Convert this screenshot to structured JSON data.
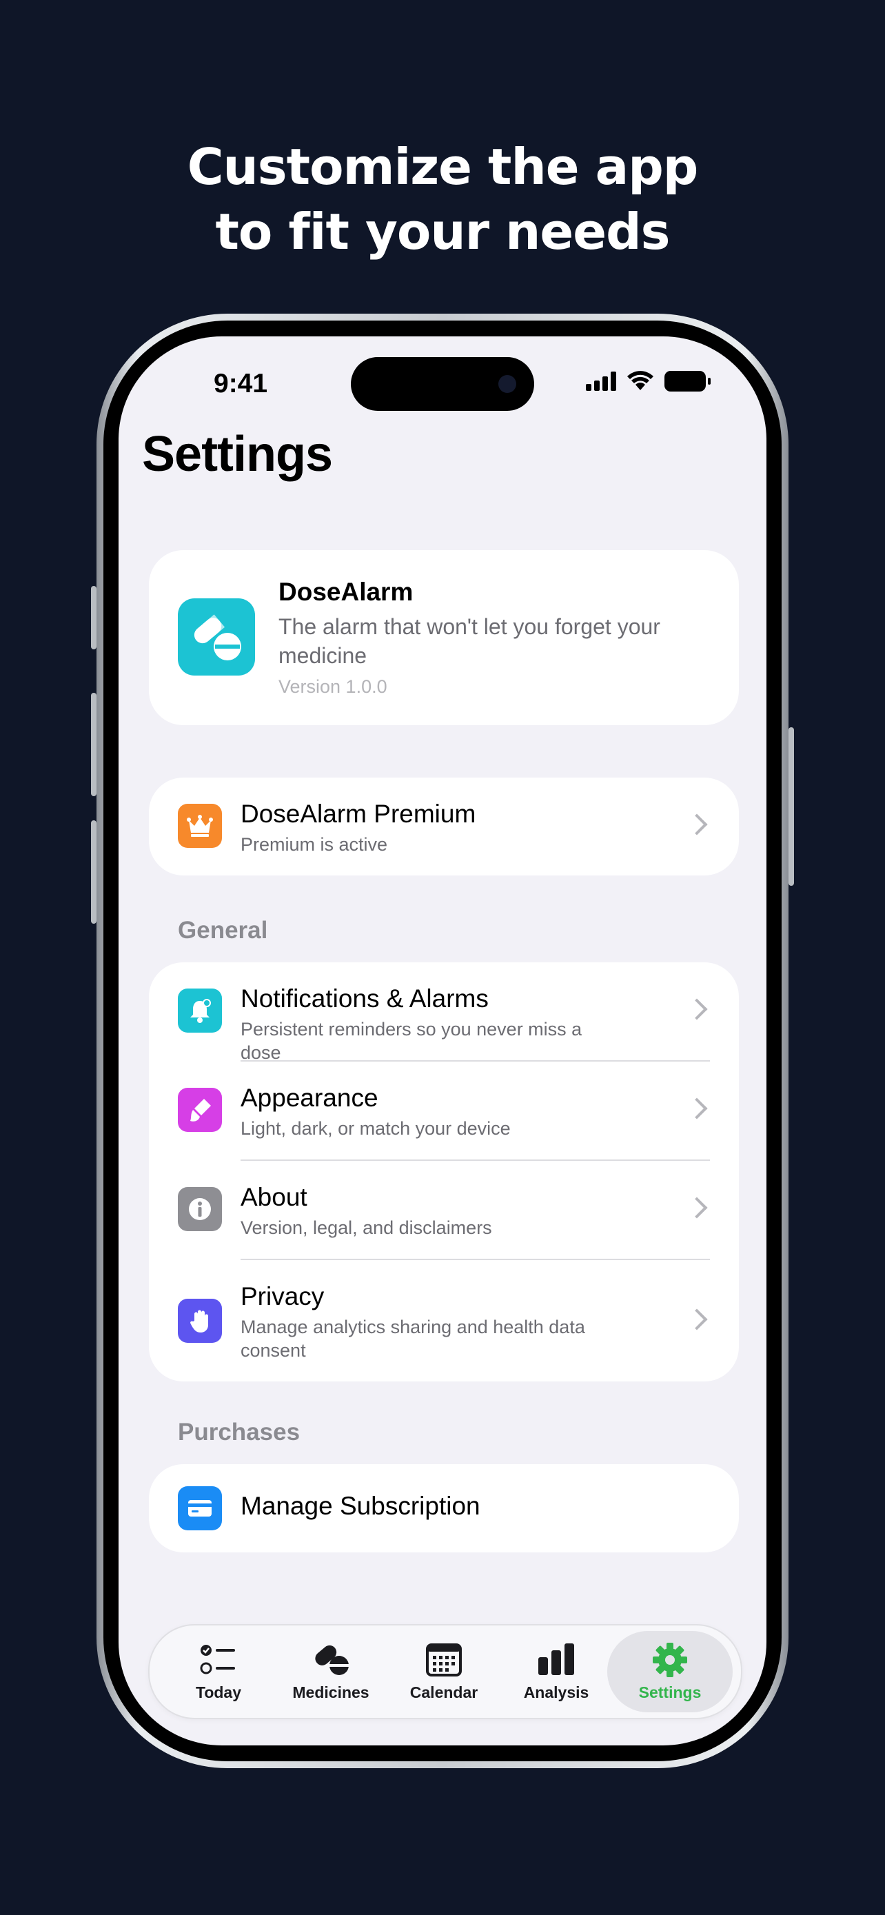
{
  "headline": {
    "line1": "Customize the app",
    "line2": "to fit your needs"
  },
  "status_bar": {
    "time": "9:41"
  },
  "page": {
    "title": "Settings"
  },
  "app_card": {
    "name": "DoseAlarm",
    "description": "The alarm that won't let you forget your medicine",
    "version": "Version 1.0.0",
    "icon": "pills-icon",
    "icon_color": "#1cc3d3"
  },
  "premium": {
    "title": "DoseAlarm Premium",
    "subtitle": "Premium is active",
    "icon": "crown-icon",
    "icon_color": "#f7892b"
  },
  "general": {
    "label": "General",
    "items": [
      {
        "title": "Notifications & Alarms",
        "subtitle": "Persistent reminders so you never miss a dose",
        "icon": "bell-icon",
        "icon_color": "#1cc3d3"
      },
      {
        "title": "Appearance",
        "subtitle": "Light, dark, or match your device",
        "icon": "paintbrush-icon",
        "icon_color": "#d63fe6"
      },
      {
        "title": "About",
        "subtitle": "Version, legal, and disclaimers",
        "icon": "info-icon",
        "icon_color": "#8e8e93"
      },
      {
        "title": "Privacy",
        "subtitle": "Manage analytics sharing and health data consent",
        "icon": "hand-icon",
        "icon_color": "#5d55f0"
      }
    ]
  },
  "purchases": {
    "label": "Purchases",
    "items": [
      {
        "title": "Manage Subscription",
        "icon": "credit-card-icon",
        "icon_color": "#1a8cf5"
      }
    ]
  },
  "tabbar": {
    "active": "Settings",
    "accent": "#33b54c",
    "tabs": [
      {
        "label": "Today",
        "icon": "checklist-icon"
      },
      {
        "label": "Medicines",
        "icon": "pills-icon"
      },
      {
        "label": "Calendar",
        "icon": "calendar-icon"
      },
      {
        "label": "Analysis",
        "icon": "bar-chart-icon"
      },
      {
        "label": "Settings",
        "icon": "gear-icon"
      }
    ]
  }
}
